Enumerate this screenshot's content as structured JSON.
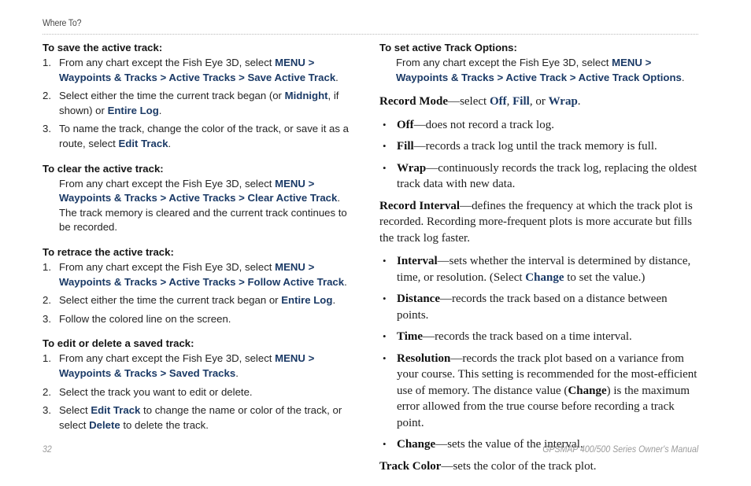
{
  "page": {
    "running_head": "Where To?",
    "page_number": "32",
    "manual_title": "GPSMAP 400/500 Series Owner's Manual",
    "accent_color": "#1b3a66",
    "text_color": "#242424",
    "footer_color": "#9b9b9b"
  },
  "left_column": {
    "sections": [
      {
        "heading": "To save the active track:",
        "items": [
          {
            "number": "1.",
            "parts": [
              {
                "t": "From any chart except the Fish Eye 3D, select ",
                "s": "plain"
              },
              {
                "t": "MENU",
                "s": "ui"
              },
              {
                "t": " > ",
                "s": "ui"
              },
              {
                "t": "Waypoints & Tracks",
                "s": "ui"
              },
              {
                "t": " > ",
                "s": "ui"
              },
              {
                "t": "Active Tracks",
                "s": "ui"
              },
              {
                "t": " > ",
                "s": "ui"
              },
              {
                "t": "Save Active Track",
                "s": "ui"
              },
              {
                "t": ".",
                "s": "plain"
              }
            ]
          },
          {
            "number": "2.",
            "parts": [
              {
                "t": "Select either the time the current track began (or ",
                "s": "plain"
              },
              {
                "t": "Midnight",
                "s": "ui"
              },
              {
                "t": ", if shown) or ",
                "s": "plain"
              },
              {
                "t": "Entire Log",
                "s": "ui"
              },
              {
                "t": ".",
                "s": "plain"
              }
            ]
          },
          {
            "number": "3.",
            "parts": [
              {
                "t": "To name the track, change the color of the track, or save it as a route, select ",
                "s": "plain"
              },
              {
                "t": "Edit Track",
                "s": "ui"
              },
              {
                "t": ".",
                "s": "plain"
              }
            ]
          }
        ]
      },
      {
        "heading": "To clear the active track:",
        "items": [
          {
            "number": "",
            "parts": [
              {
                "t": "From any chart except the Fish Eye 3D, select ",
                "s": "plain"
              },
              {
                "t": "MENU",
                "s": "ui"
              },
              {
                "t": " > ",
                "s": "ui"
              },
              {
                "t": "Waypoints & Tracks",
                "s": "ui"
              },
              {
                "t": " > ",
                "s": "ui"
              },
              {
                "t": "Active Tracks",
                "s": "ui"
              },
              {
                "t": " > ",
                "s": "ui"
              },
              {
                "t": "Clear Active Track",
                "s": "ui"
              },
              {
                "t": ". The track memory is cleared and the current track continues to be recorded.",
                "s": "plain"
              }
            ]
          }
        ]
      },
      {
        "heading": "To retrace the active track:",
        "items": [
          {
            "number": "1.",
            "parts": [
              {
                "t": "From any chart except the Fish Eye 3D, select ",
                "s": "plain"
              },
              {
                "t": "MENU",
                "s": "ui"
              },
              {
                "t": " > ",
                "s": "ui"
              },
              {
                "t": "Waypoints & Tracks",
                "s": "ui"
              },
              {
                "t": " > ",
                "s": "ui"
              },
              {
                "t": "Active Tracks",
                "s": "ui"
              },
              {
                "t": " > ",
                "s": "ui"
              },
              {
                "t": "Follow Active Track",
                "s": "ui"
              },
              {
                "t": ".",
                "s": "plain"
              }
            ]
          },
          {
            "number": "2.",
            "parts": [
              {
                "t": "Select either the time the current track began or ",
                "s": "plain"
              },
              {
                "t": "Entire Log",
                "s": "ui"
              },
              {
                "t": ".",
                "s": "plain"
              }
            ]
          },
          {
            "number": "3.",
            "parts": [
              {
                "t": "Follow the colored line on the screen.",
                "s": "plain"
              }
            ]
          }
        ]
      },
      {
        "heading": "To edit or delete a saved track:",
        "items": [
          {
            "number": "1.",
            "parts": [
              {
                "t": "From any chart except the Fish Eye 3D, select ",
                "s": "plain"
              },
              {
                "t": "MENU",
                "s": "ui"
              },
              {
                "t": " > ",
                "s": "ui"
              },
              {
                "t": "Waypoints & Tracks",
                "s": "ui"
              },
              {
                "t": " > ",
                "s": "ui"
              },
              {
                "t": "Saved Tracks",
                "s": "ui"
              },
              {
                "t": ".",
                "s": "plain"
              }
            ]
          },
          {
            "number": "2.",
            "parts": [
              {
                "t": "Select the track you want to edit or delete.",
                "s": "plain"
              }
            ]
          },
          {
            "number": "3.",
            "parts": [
              {
                "t": "Select ",
                "s": "plain"
              },
              {
                "t": "Edit Track",
                "s": "ui"
              },
              {
                "t": " to change the name or color of the track, or select ",
                "s": "plain"
              },
              {
                "t": "Delete",
                "s": "ui"
              },
              {
                "t": " to delete the track.",
                "s": "plain"
              }
            ]
          }
        ]
      }
    ]
  },
  "right_column": {
    "heading": "To set active Track Options:",
    "heading_instruction": [
      {
        "t": "From any chart except the Fish Eye 3D, select ",
        "s": "plain"
      },
      {
        "t": "MENU",
        "s": "ui"
      },
      {
        "t": " > ",
        "s": "ui"
      },
      {
        "t": "Waypoints & Tracks",
        "s": "ui"
      },
      {
        "t": " > ",
        "s": "ui"
      },
      {
        "t": "Active Track",
        "s": "ui"
      },
      {
        "t": " > ",
        "s": "ui"
      },
      {
        "t": "Active Track Options",
        "s": "ui"
      },
      {
        "t": ".",
        "s": "plain"
      }
    ],
    "blocks": [
      {
        "kind": "para",
        "parts": [
          {
            "t": "Record Mode",
            "s": "bold"
          },
          {
            "t": "—select ",
            "s": "plain"
          },
          {
            "t": "Off",
            "s": "ui"
          },
          {
            "t": ", ",
            "s": "plain"
          },
          {
            "t": "Fill",
            "s": "ui"
          },
          {
            "t": ", or ",
            "s": "plain"
          },
          {
            "t": "Wrap",
            "s": "ui"
          },
          {
            "t": ".",
            "s": "plain"
          }
        ]
      },
      {
        "kind": "bullet",
        "parts": [
          {
            "t": "Off",
            "s": "bold"
          },
          {
            "t": "—does not record a track log.",
            "s": "plain"
          }
        ]
      },
      {
        "kind": "bullet",
        "parts": [
          {
            "t": "Fill",
            "s": "bold"
          },
          {
            "t": "—records a track log until the track memory is full.",
            "s": "plain"
          }
        ]
      },
      {
        "kind": "bullet",
        "parts": [
          {
            "t": "Wrap",
            "s": "bold"
          },
          {
            "t": "—continuously records the track log, replacing the oldest track data with new data.",
            "s": "plain"
          }
        ]
      },
      {
        "kind": "para",
        "parts": [
          {
            "t": "Record Interval",
            "s": "bold"
          },
          {
            "t": "—defines the frequency at which the track plot is recorded. Recording more-frequent plots is more accurate but fills the track log faster.",
            "s": "plain"
          }
        ]
      },
      {
        "kind": "bullet",
        "parts": [
          {
            "t": "Interval",
            "s": "bold"
          },
          {
            "t": "—sets whether the interval is determined by distance, time, or resolution. (Select ",
            "s": "plain"
          },
          {
            "t": "Change",
            "s": "ui"
          },
          {
            "t": " to set the value.)",
            "s": "plain"
          }
        ]
      },
      {
        "kind": "bullet",
        "parts": [
          {
            "t": "Distance",
            "s": "bold"
          },
          {
            "t": "—records the track based on a distance between points.",
            "s": "plain"
          }
        ]
      },
      {
        "kind": "bullet",
        "parts": [
          {
            "t": "Time",
            "s": "bold"
          },
          {
            "t": "—records the track based on a time interval.",
            "s": "plain"
          }
        ]
      },
      {
        "kind": "bullet",
        "parts": [
          {
            "t": "Resolution",
            "s": "bold"
          },
          {
            "t": "—records the track plot based on a variance from your course. This setting is recommended for the most-efficient use of memory. The distance value (",
            "s": "plain"
          },
          {
            "t": "Change",
            "s": "bold"
          },
          {
            "t": ") is the maximum error allowed from the true course before recording a track point.",
            "s": "plain"
          }
        ]
      },
      {
        "kind": "bullet",
        "parts": [
          {
            "t": "Change",
            "s": "bold"
          },
          {
            "t": "—sets the value of the interval.",
            "s": "plain"
          }
        ]
      },
      {
        "kind": "para",
        "parts": [
          {
            "t": "Track Color",
            "s": "bold"
          },
          {
            "t": "—sets the color of the track plot.",
            "s": "plain"
          }
        ]
      }
    ]
  }
}
